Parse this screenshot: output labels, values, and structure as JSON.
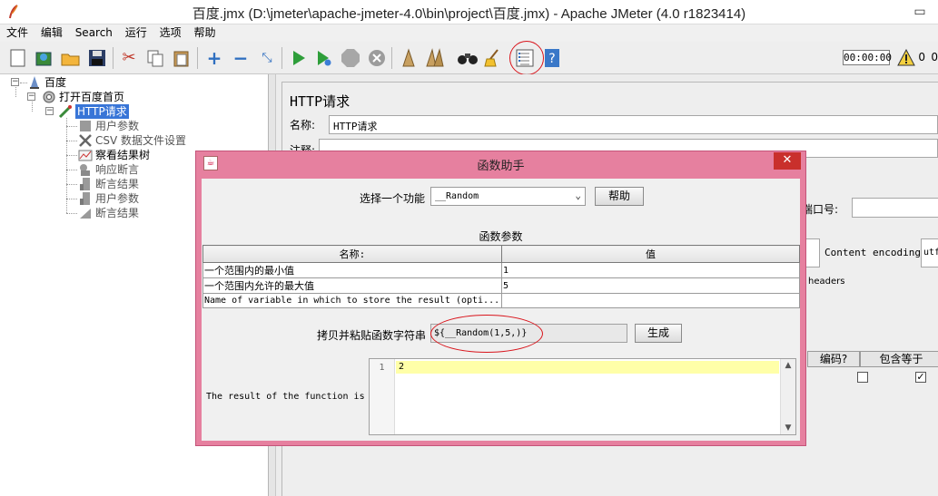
{
  "window": {
    "title": "百度.jmx (D:\\jmeter\\apache-jmeter-4.0\\bin\\project\\百度.jmx) - Apache JMeter (4.0 r1823414)",
    "control_label": "▭"
  },
  "menu": {
    "items": [
      {
        "label": "文件"
      },
      {
        "label": "编辑"
      },
      {
        "label": "Search"
      },
      {
        "label": "运行"
      },
      {
        "label": "选项"
      },
      {
        "label": "帮助"
      }
    ]
  },
  "toolbar": {
    "timer": "00:00:00",
    "warning_count": "0",
    "error_count": "0",
    "icons": [
      "new-icon",
      "templates-icon",
      "open-icon",
      "save-icon",
      "cut-icon",
      "copy-icon",
      "paste-icon",
      "expand-icon",
      "collapse-icon",
      "toggle-icon",
      "start-icon",
      "start-no-pauses-icon",
      "stop-icon",
      "shutdown-icon",
      "clear-icon",
      "clear-all-icon",
      "search-icon",
      "reset-search-icon",
      "function-helper-icon",
      "help-icon"
    ],
    "highlight_color": "#d9141b"
  },
  "tree": {
    "items": [
      {
        "label": "百度",
        "icon": "test-plan-icon"
      },
      {
        "label": "打开百度首页",
        "icon": "thread-group-icon"
      },
      {
        "label": "HTTP请求",
        "icon": "http-sampler-icon",
        "selected": true
      },
      {
        "label": "用户参数",
        "icon": "preprocessor-icon"
      },
      {
        "label": "CSV 数据文件设置",
        "icon": "config-icon"
      },
      {
        "label": "察看结果树",
        "icon": "listener-icon"
      },
      {
        "label": "响应断言",
        "icon": "assertion-icon"
      },
      {
        "label": "断言结果",
        "icon": "assertion-results-icon"
      },
      {
        "label": "用户参数",
        "icon": "preprocessor-icon"
      },
      {
        "label": "断言结果",
        "icon": "assertion-results-icon"
      }
    ]
  },
  "main": {
    "section_title": "HTTP请求",
    "name_label": "名称:",
    "name_value": "HTTP请求",
    "comment_label": "注释:",
    "port_label": "端口号:",
    "content_encoding_label": "Content encoding:",
    "content_encoding_value": "utf",
    "headers_text": "headers",
    "col_encode": "编码?",
    "col_include": "包含等于"
  },
  "dialog": {
    "title": "函数助手",
    "close_label": "✕",
    "choose_label": "选择一个功能",
    "function_selected": "__Random",
    "help_button": "帮助",
    "params_title": "函数参数",
    "table": {
      "headers": [
        "名称:",
        "值"
      ],
      "rows": [
        {
          "name": "一个范围内的最小值",
          "value": "1"
        },
        {
          "name": "一个范围内允许的最大值",
          "value": "5"
        },
        {
          "name": "Name of variable in which to store the result (opti...",
          "value": ""
        }
      ]
    },
    "copy_label": "拷贝并粘贴函数字符串",
    "function_string": "${__Random(1,5,)}",
    "generate_button": "生成",
    "result_label": "The result of the function is",
    "result_line_number": "1",
    "result_value": "2",
    "accent_color": "#e6809f"
  }
}
